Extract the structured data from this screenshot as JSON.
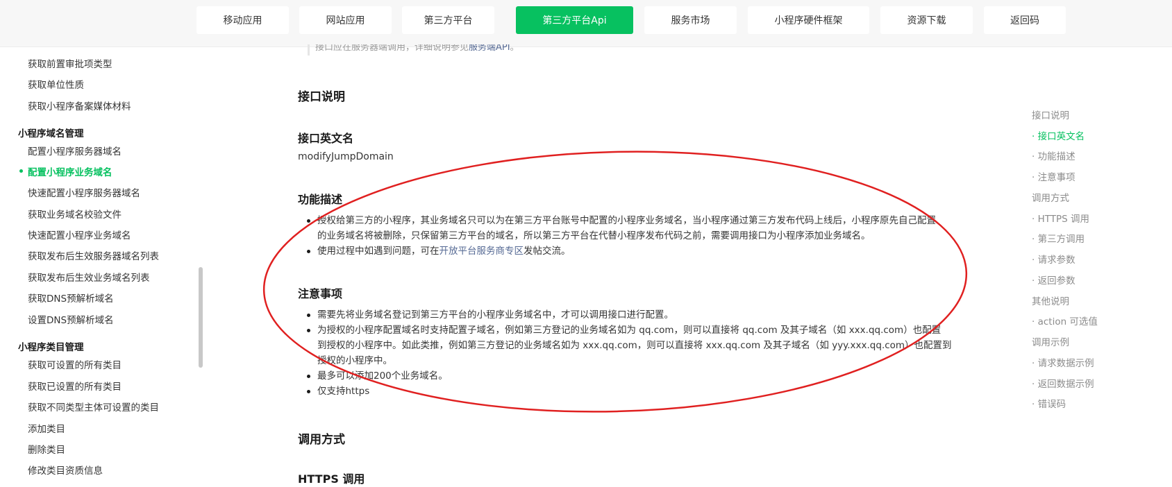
{
  "topnav": {
    "tabs": [
      {
        "label": "移动应用",
        "active": false
      },
      {
        "label": "网站应用",
        "active": false
      },
      {
        "label": "第三方平台",
        "active": false
      },
      {
        "label": "第三方平台Api",
        "active": true
      },
      {
        "label": "服务市场",
        "active": false
      },
      {
        "label": "小程序硬件框架",
        "active": false
      },
      {
        "label": "资源下载",
        "active": false
      },
      {
        "label": "返回码",
        "active": false
      }
    ]
  },
  "sidebar": {
    "items_top": [
      {
        "label": "获取前置审批项类型"
      },
      {
        "label": "获取单位性质"
      },
      {
        "label": "获取小程序备案媒体材料"
      }
    ],
    "group_domain": "小程序域名管理",
    "items_domain": [
      {
        "label": "配置小程序服务器域名"
      },
      {
        "label": "配置小程序业务域名",
        "active": true
      },
      {
        "label": "快速配置小程序服务器域名"
      },
      {
        "label": "获取业务域名校验文件"
      },
      {
        "label": "快速配置小程序业务域名"
      },
      {
        "label": "获取发布后生效服务器域名列表"
      },
      {
        "label": "获取发布后生效业务域名列表"
      },
      {
        "label": "获取DNS预解析域名"
      },
      {
        "label": "设置DNS预解析域名"
      }
    ],
    "group_category": "小程序类目管理",
    "items_category": [
      {
        "label": "获取可设置的所有类目"
      },
      {
        "label": "获取已设置的所有类目"
      },
      {
        "label": "获取不同类型主体可设置的类目"
      },
      {
        "label": "添加类目"
      },
      {
        "label": "删除类目"
      },
      {
        "label": "修改类目资质信息"
      }
    ]
  },
  "main": {
    "cut_note_prefix": "接口应在服务器端调用，详细说明参见",
    "cut_note_link": "服务端API",
    "cut_note_suffix": "。",
    "section_api_desc": "接口说明",
    "heading_english_name": "接口英文名",
    "english_name": "modifyJumpDomain",
    "heading_function": "功能描述",
    "function_items": {
      "0": "授权给第三方的小程序，其业务域名只可以为在第三方平台账号中配置的小程序业务域名，当小程序通过第三方发布代码上线后，小程序原先自己配置",
      "0b": "的业务域名将被删除，只保留第三方平台的域名，所以第三方平台在代替小程序发布代码之前，需要调用接口为小程序添加业务域名。",
      "1_prefix": "使用过程中如遇到问题，可在",
      "1_link": "开放平台服务商专区",
      "1_suffix": "发帖交流。"
    },
    "heading_notes": "注意事项",
    "notes_items": {
      "0": "需要先将业务域名登记到第三方平台的小程序业务域名中，才可以调用接口进行配置。",
      "1": "为授权的小程序配置域名时支持配置子域名，例如第三方登记的业务域名如为 qq.com，则可以直接将 qq.com 及其子域名（如 xxx.qq.com）也配置",
      "1b": "到授权的小程序中。如此类推，例如第三方登记的业务域名如为 xxx.qq.com，则可以直接将 xxx.qq.com 及其子域名（如 yyy.xxx.qq.com）也配置到",
      "1c": "授权的小程序中。",
      "2": "最多可以添加200个业务域名。",
      "3": "仅支持https"
    },
    "section_call_method": "调用方式",
    "heading_https": "HTTPS 调用"
  },
  "toc": {
    "items": [
      {
        "label": "接口说明",
        "active": false
      },
      {
        "label": "· 接口英文名",
        "active": true
      },
      {
        "label": "· 功能描述",
        "active": false
      },
      {
        "label": "· 注意事项",
        "active": false
      },
      {
        "label": "调用方式",
        "active": false
      },
      {
        "label": "· HTTPS 调用",
        "active": false
      },
      {
        "label": "· 第三方调用",
        "active": false
      },
      {
        "label": "· 请求参数",
        "active": false
      },
      {
        "label": "· 返回参数",
        "active": false
      },
      {
        "label": "其他说明",
        "active": false
      },
      {
        "label": "· action 可选值",
        "active": false
      },
      {
        "label": "调用示例",
        "active": false
      },
      {
        "label": "· 请求数据示例",
        "active": false
      },
      {
        "label": "· 返回数据示例",
        "active": false
      },
      {
        "label": "· 错误码",
        "active": false
      }
    ]
  },
  "colors": {
    "accent": "#07c160",
    "link": "#576b95",
    "annotation": "#e02020"
  }
}
